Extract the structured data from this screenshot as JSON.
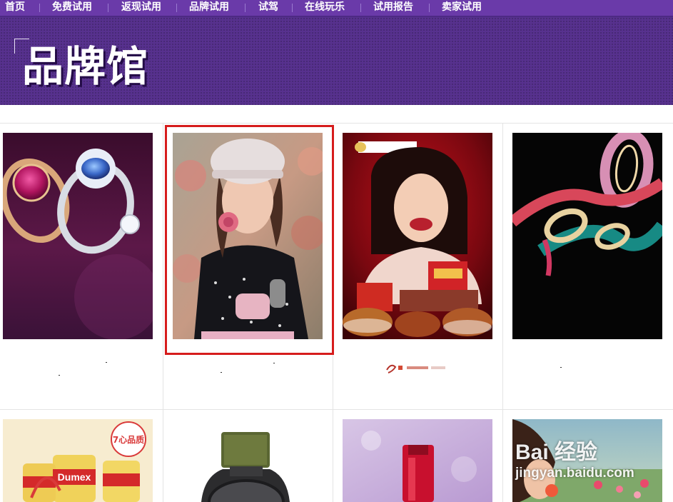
{
  "nav": {
    "items": [
      {
        "label": "首页"
      },
      {
        "label": "免费试用"
      },
      {
        "label": "返现试用"
      },
      {
        "label": "品牌试用"
      },
      {
        "label": "试驾"
      },
      {
        "label": "在线玩乐"
      },
      {
        "label": "试用报告"
      },
      {
        "label": "卖家试用"
      }
    ]
  },
  "banner": {
    "title": "品牌馆"
  },
  "products": [
    {
      "image": "jewelry-rings"
    },
    {
      "image": "knit-hat-woman",
      "selected": true
    },
    {
      "image": "snack-food-woman"
    },
    {
      "image": "abstract-ribbon-logo"
    },
    {
      "image": "dumex-milk-powder"
    },
    {
      "image": "wristwatch"
    },
    {
      "image": "red-cosmetic-bottle"
    },
    {
      "image": "woman-flowers"
    }
  ],
  "dumex": {
    "brand": "Dumex",
    "badge": "7心品质"
  },
  "watermark": {
    "top": "Bai 经验",
    "bottom": "jingyan.baidu.com"
  },
  "colors": {
    "nav": "#6a3aa9",
    "banner": "#57318e",
    "selection": "#d61c1c"
  }
}
